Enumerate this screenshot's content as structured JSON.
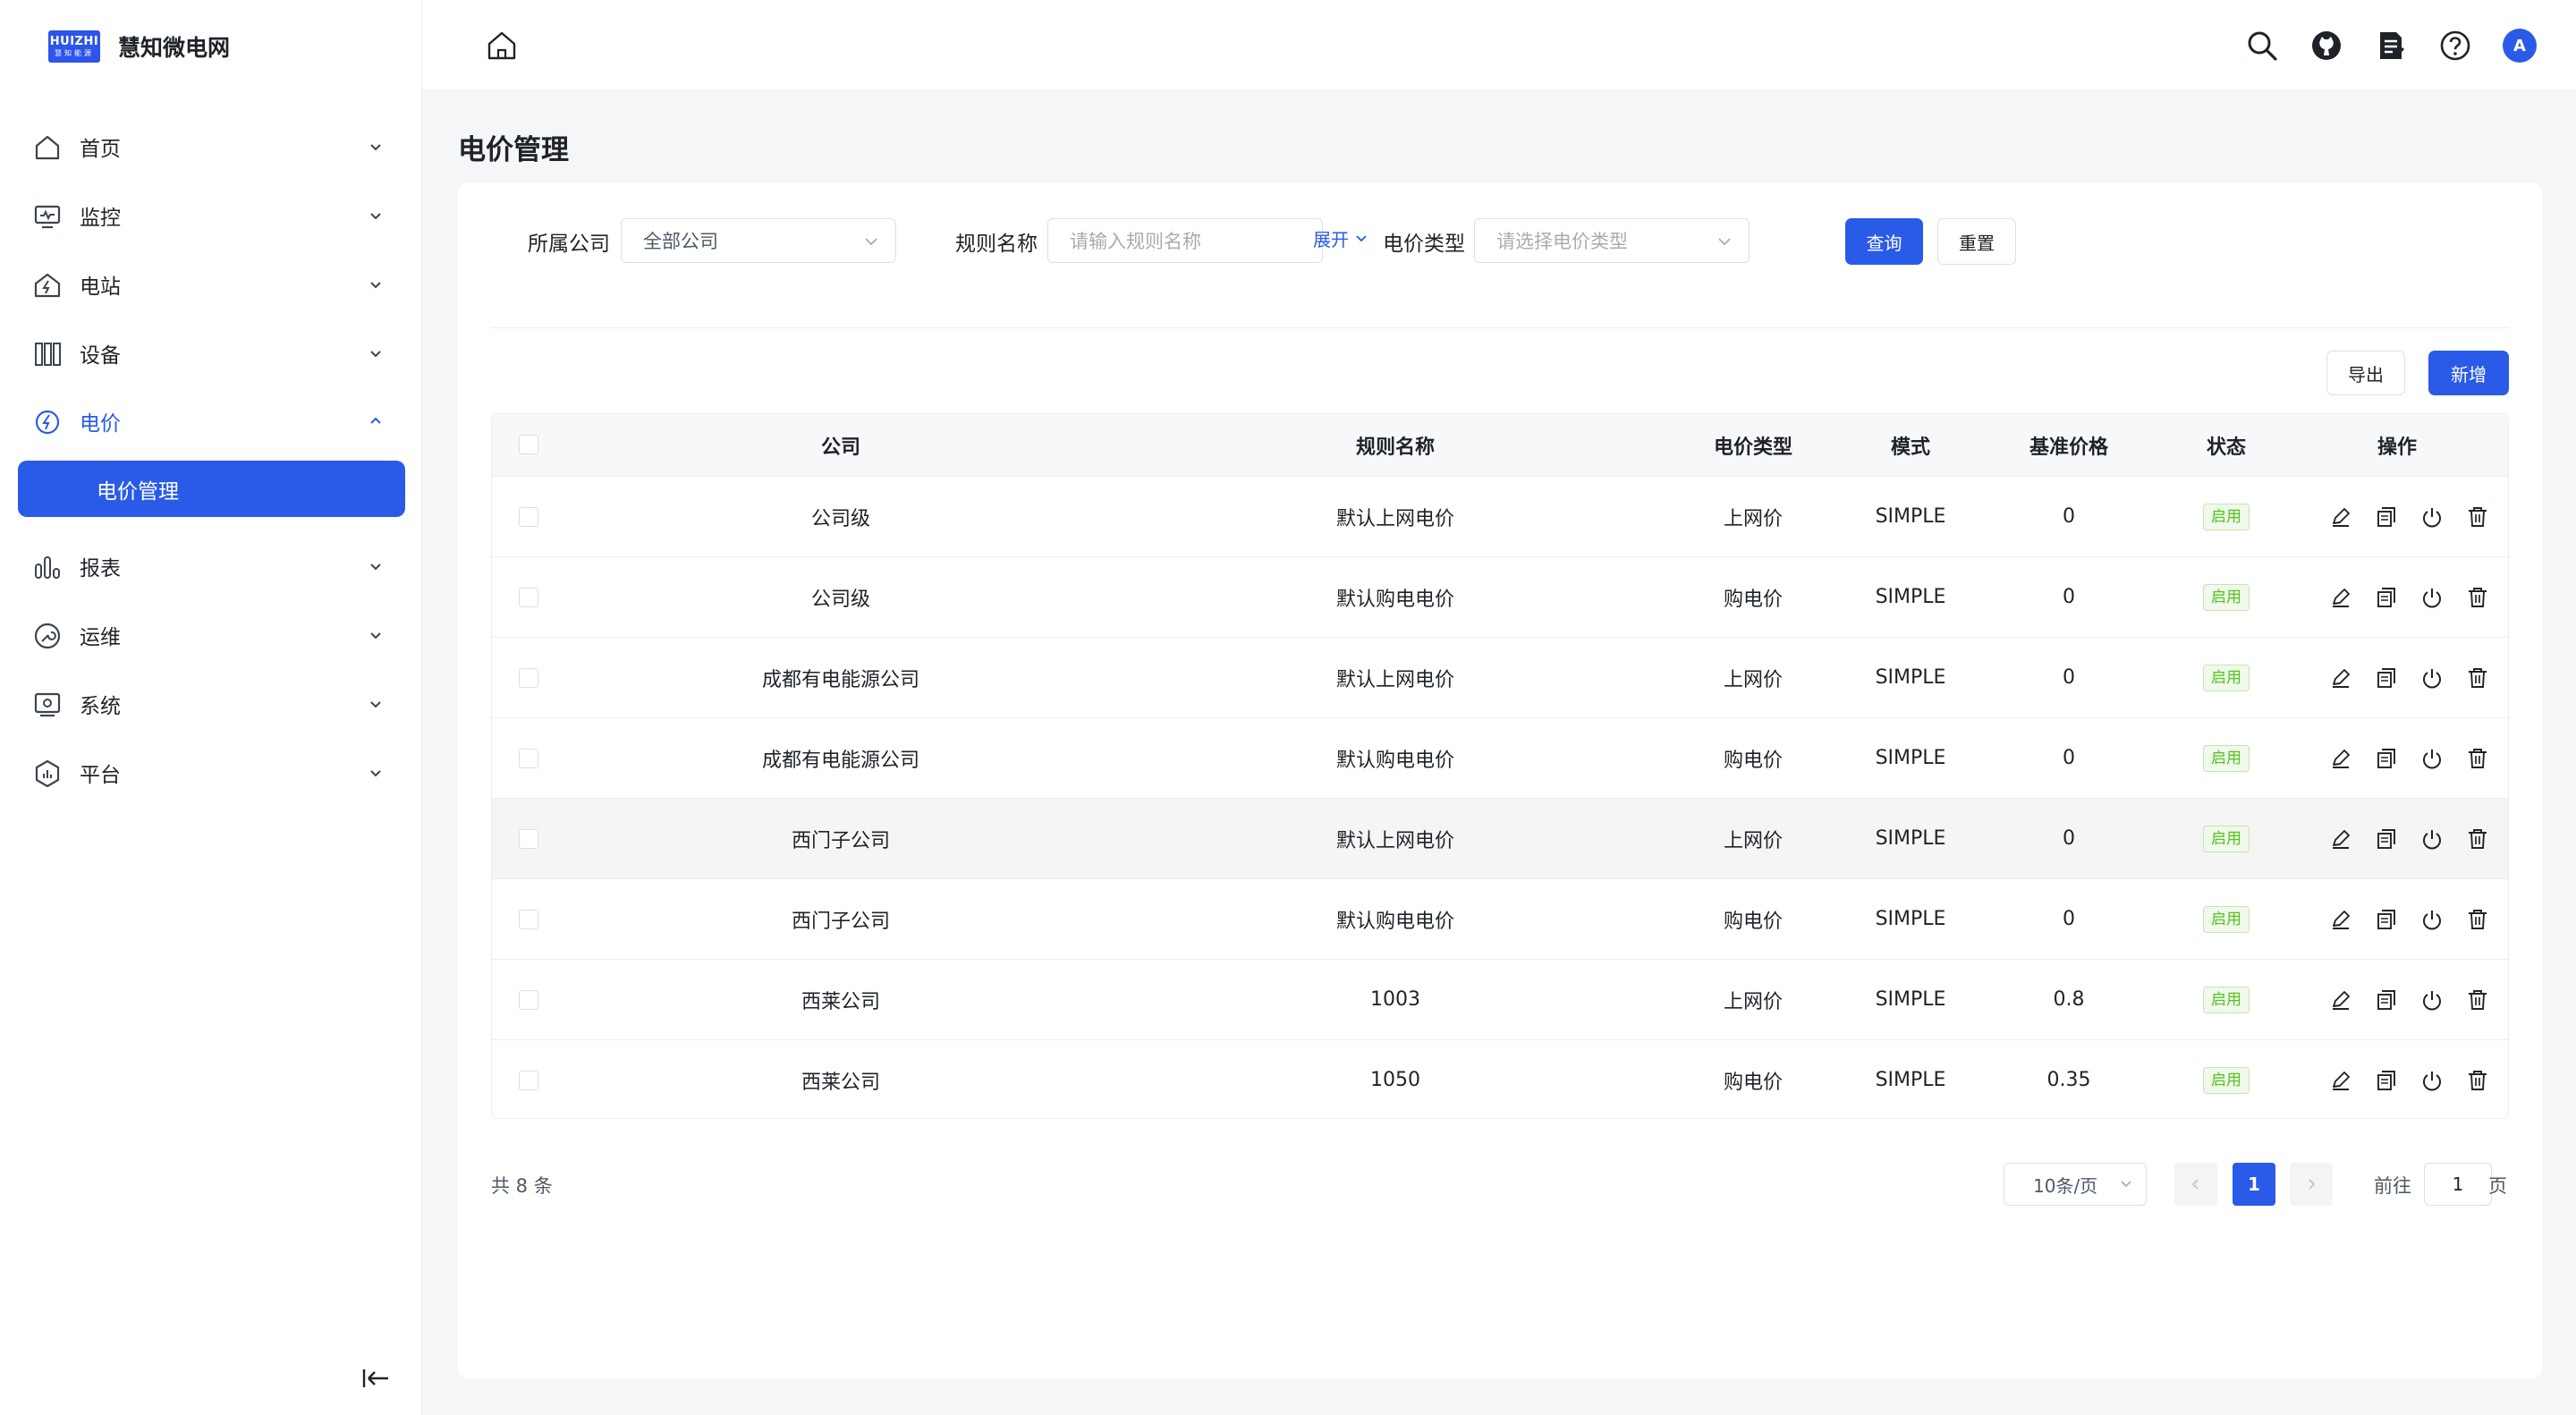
{
  "brand": {
    "badge_line1": "HUIZHI",
    "badge_line2": "慧知能源",
    "name": "慧知微电网"
  },
  "sidebar": {
    "items": [
      {
        "label": "首页",
        "icon": "home-icon"
      },
      {
        "label": "监控",
        "icon": "monitor-icon"
      },
      {
        "label": "电站",
        "icon": "station-icon"
      },
      {
        "label": "设备",
        "icon": "device-icon"
      },
      {
        "label": "电价",
        "icon": "electricity-price-icon",
        "active": true
      },
      {
        "label": "报表",
        "icon": "report-icon"
      },
      {
        "label": "运维",
        "icon": "maintenance-icon"
      },
      {
        "label": "系统",
        "icon": "system-icon"
      },
      {
        "label": "平台",
        "icon": "platform-icon"
      }
    ],
    "sub_item": "电价管理"
  },
  "topbar": {
    "icons": [
      "search-icon",
      "github-icon",
      "docs-icon",
      "help-icon"
    ],
    "avatar": "A"
  },
  "page": {
    "title": "电价管理"
  },
  "filters": {
    "company_label": "所属公司",
    "company_value": "全部公司",
    "rule_label": "规则名称",
    "rule_placeholder": "请输入规则名称",
    "type_label": "电价类型",
    "type_placeholder": "请选择电价类型",
    "expand": "展开",
    "query": "查询",
    "reset": "重置"
  },
  "toolbar": {
    "export": "导出",
    "add": "新增"
  },
  "table": {
    "headers": {
      "company": "公司",
      "rule": "规则名称",
      "type": "电价类型",
      "mode": "模式",
      "base_price": "基准价格",
      "status": "状态",
      "actions": "操作"
    },
    "rows": [
      {
        "company": "公司级",
        "rule": "默认上网电价",
        "type": "上网价",
        "mode": "SIMPLE",
        "base_price": "0",
        "status": "启用"
      },
      {
        "company": "公司级",
        "rule": "默认购电电价",
        "type": "购电价",
        "mode": "SIMPLE",
        "base_price": "0",
        "status": "启用"
      },
      {
        "company": "成都有电能源公司",
        "rule": "默认上网电价",
        "type": "上网价",
        "mode": "SIMPLE",
        "base_price": "0",
        "status": "启用"
      },
      {
        "company": "成都有电能源公司",
        "rule": "默认购电电价",
        "type": "购电价",
        "mode": "SIMPLE",
        "base_price": "0",
        "status": "启用"
      },
      {
        "company": "西门子公司",
        "rule": "默认上网电价",
        "type": "上网价",
        "mode": "SIMPLE",
        "base_price": "0",
        "status": "启用"
      },
      {
        "company": "西门子公司",
        "rule": "默认购电电价",
        "type": "购电价",
        "mode": "SIMPLE",
        "base_price": "0",
        "status": "启用"
      },
      {
        "company": "西莱公司",
        "rule": "1003",
        "type": "上网价",
        "mode": "SIMPLE",
        "base_price": "0.8",
        "status": "启用"
      },
      {
        "company": "西莱公司",
        "rule": "1050",
        "type": "购电价",
        "mode": "SIMPLE",
        "base_price": "0.35",
        "status": "启用"
      }
    ]
  },
  "pagination": {
    "total": "共 8 条",
    "page_size": "10条/页",
    "current_page": "1",
    "goto_prefix": "前往",
    "goto_value": "1",
    "goto_suffix": "页"
  },
  "colors": {
    "primary": "#2a5ae8",
    "status_green": "#52c41a",
    "page_bg": "#f5f6f8"
  }
}
